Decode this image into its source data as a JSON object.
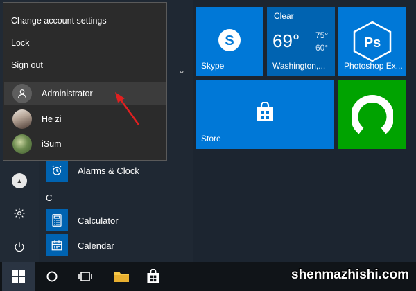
{
  "account_menu": {
    "items": [
      "Change account settings",
      "Lock",
      "Sign out"
    ],
    "accounts": [
      {
        "name": "Administrator",
        "selected": true
      },
      {
        "name": "He zi",
        "selected": false
      },
      {
        "name": "iSum",
        "selected": false
      }
    ]
  },
  "app_list": {
    "apps": [
      {
        "label": "Alarms & Clock",
        "icon": "alarm-clock-icon"
      },
      {
        "label": "Calculator",
        "icon": "calculator-icon"
      },
      {
        "label": "Calendar",
        "icon": "calendar-icon"
      }
    ],
    "section_letter": "C"
  },
  "tiles": {
    "skype": {
      "label": "Skype",
      "color": "#0078d7",
      "icon": "skype-icon"
    },
    "weather": {
      "condition": "Clear",
      "temp": "69°",
      "high": "75°",
      "low": "60°",
      "location": "Washington,...",
      "color": "#0063b1"
    },
    "photoshop": {
      "label": "Photoshop Ex...",
      "icon_text": "Ps",
      "color": "#0078d7"
    },
    "store": {
      "label": "Store",
      "color": "#0078d7",
      "icon": "store-icon"
    },
    "app_tile": {
      "color": "#00a300",
      "icon": "green-ring-icon"
    }
  },
  "rail": {
    "icons": [
      "user-avatar-icon",
      "settings-icon",
      "power-icon"
    ]
  },
  "taskbar": {
    "icons": [
      "windows-start-icon",
      "cortana-icon",
      "task-view-icon",
      "file-explorer-icon",
      "store-icon"
    ]
  },
  "watermark": "shenmazhishi.com",
  "colors": {
    "accent": "#0078d7",
    "popup_bg": "#2b2b2b",
    "annotation_arrow": "#e02020"
  }
}
